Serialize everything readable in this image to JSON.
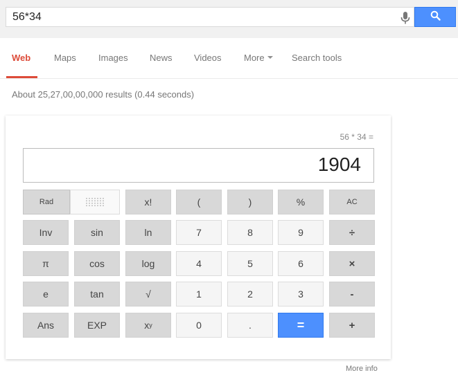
{
  "search": {
    "query": "56*34"
  },
  "tabs": [
    {
      "label": "Web",
      "active": true
    },
    {
      "label": "Maps"
    },
    {
      "label": "Images"
    },
    {
      "label": "News"
    },
    {
      "label": "Videos"
    },
    {
      "label": "More"
    },
    {
      "label": "Search tools"
    }
  ],
  "results": {
    "count_text": "About 25,27,00,00,000 results (0.44 seconds)"
  },
  "calculator": {
    "expression": "56 * 34 =",
    "result": "1904",
    "keys": {
      "rad": "Rad",
      "factorial": "x!",
      "open_paren": "(",
      "close_paren": ")",
      "percent": "%",
      "clear": "AC",
      "inv": "Inv",
      "sin": "sin",
      "ln": "ln",
      "seven": "7",
      "eight": "8",
      "nine": "9",
      "divide": "÷",
      "pi": "π",
      "cos": "cos",
      "log": "log",
      "four": "4",
      "five": "5",
      "six": "6",
      "multiply": "×",
      "e": "e",
      "tan": "tan",
      "sqrt": "√",
      "one": "1",
      "two": "2",
      "three": "3",
      "minus": "-",
      "ans": "Ans",
      "exp": "EXP",
      "power_base": "x",
      "power_exp": "y",
      "zero": "0",
      "decimal": ".",
      "equals": "=",
      "plus": "+"
    },
    "more_info": "More info"
  },
  "colors": {
    "accent_red": "#dd4b39",
    "search_blue": "#4d90fe"
  },
  "icons": {
    "mic": "microphone-icon",
    "search": "magnifier-icon"
  }
}
